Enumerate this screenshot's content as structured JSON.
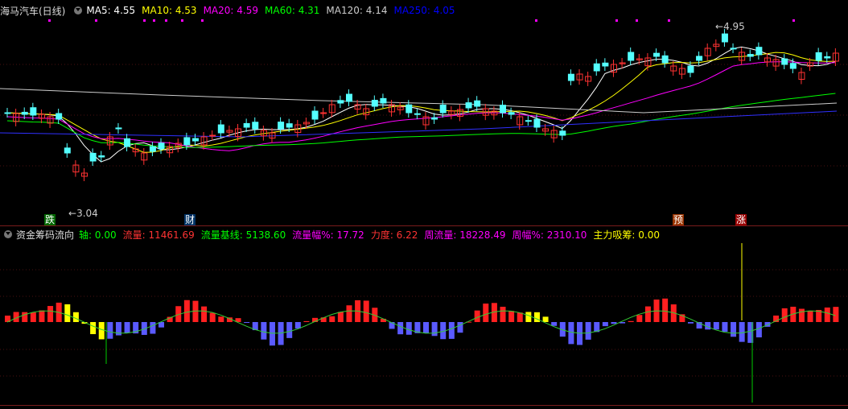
{
  "main_panel": {
    "stock_name": "海马汽车(日线)",
    "ma_labels": [
      {
        "label": "MA5:",
        "value": "4.55",
        "color": "#ffffff"
      },
      {
        "label": "MA10:",
        "value": "4.53",
        "color": "#ffff00"
      },
      {
        "label": "MA20:",
        "value": "4.59",
        "color": "#ff00ff"
      },
      {
        "label": "MA60:",
        "value": "4.31",
        "color": "#00ff00"
      },
      {
        "label": "MA120:",
        "value": "4.14",
        "color": "#cccccc"
      },
      {
        "label": "MA250:",
        "value": "4.05",
        "color": "#0000ff"
      }
    ],
    "high_marker": "4.95",
    "low_marker": "3.04",
    "tags": [
      {
        "text": "跌",
        "bg": "#006600"
      },
      {
        "text": "财",
        "bg": "#003366"
      },
      {
        "text": "预",
        "bg": "#993300"
      },
      {
        "text": "涨",
        "bg": "#990000"
      }
    ]
  },
  "indicator_panel": {
    "title": "资金筹码流向",
    "items": [
      {
        "label": "轴:",
        "value": "0.00",
        "color": "#00ff00"
      },
      {
        "label": "流量:",
        "value": "11461.69",
        "color": "#ff3333"
      },
      {
        "label": "流量基线:",
        "value": "5138.60",
        "color": "#00ff00"
      },
      {
        "label": "流量幅%:",
        "value": "17.72",
        "color": "#ff00ff"
      },
      {
        "label": "力度:",
        "value": "6.22",
        "color": "#ff3333"
      },
      {
        "label": "周流量:",
        "value": "18228.49",
        "color": "#ff00ff"
      },
      {
        "label": "周幅%:",
        "value": "2310.10",
        "color": "#ff00ff"
      },
      {
        "label": "主力吸筹:",
        "value": "0.00",
        "color": "#ffff00"
      }
    ]
  },
  "colors": {
    "up": "#ff3232",
    "down": "#54ffff",
    "background": "#000000"
  }
}
